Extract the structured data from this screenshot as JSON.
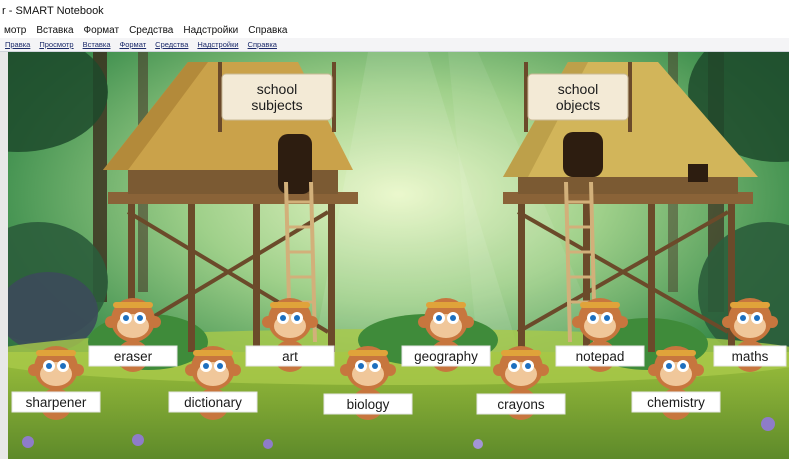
{
  "window": {
    "title": "r - SMART Notebook"
  },
  "menu_primary": [
    "мотр",
    "Вставка",
    "Формат",
    "Средства",
    "Надстройки",
    "Справка"
  ],
  "menu_secondary": [
    "Правка",
    "Просмотр",
    "Вставка",
    "Формат",
    "Средства",
    "Надстройки",
    "Справка"
  ],
  "huts": {
    "left_sign": [
      "school",
      "subjects"
    ],
    "right_sign": [
      "school",
      "objects"
    ]
  },
  "monkeys": {
    "top_row": [
      "eraser",
      "art",
      "geography",
      "notepad",
      "maths"
    ],
    "bottom_row": [
      "sharpener",
      "dictionary",
      "biology",
      "crayons",
      "chemistry"
    ]
  },
  "colors": {
    "jungle_light": "#cfe9a6",
    "jungle_mid": "#3f8f4e",
    "jungle_dark": "#1f4d33",
    "hut_roof": "#caa24a",
    "hut_wood": "#7b5a33",
    "sign_bg": "#f3ead6",
    "monkey_fur": "#c7763e",
    "label_bg": "#ffffff"
  }
}
